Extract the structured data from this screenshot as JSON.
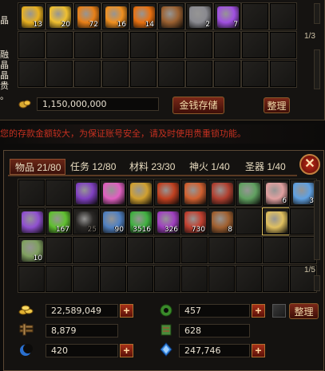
{
  "warehouse": {
    "side_text": [
      "晶",
      "融",
      "晶",
      "晶",
      "贵",
      "。"
    ],
    "page": "1/3",
    "money": "1,150,000,000",
    "store_button": "金钱存储",
    "sort_button": "整理",
    "items": [
      {
        "name": "gold-crystal-icon",
        "qty": "13",
        "color": "#e8b020"
      },
      {
        "name": "gold-shard-icon",
        "qty": "20",
        "color": "#f0c030"
      },
      {
        "name": "fire-orb-icon",
        "qty": "72",
        "color": "#e88018"
      },
      {
        "name": "fire-orb-icon",
        "qty": "16",
        "color": "#f09020"
      },
      {
        "name": "fire-orb-icon",
        "qty": "14",
        "color": "#e87010"
      },
      {
        "name": "armor-icon",
        "qty": "",
        "color": "#9a6030"
      },
      {
        "name": "chest-icon",
        "qty": "2",
        "color": "#8a8a90"
      },
      {
        "name": "purple-gem-icon",
        "qty": "7",
        "color": "#a050e0"
      }
    ]
  },
  "warning": "您的存款金额较大，为保证账号安全，请及时使用贵重锁功能。",
  "bag": {
    "tabs": [
      {
        "label": "物品",
        "count": "21/80"
      },
      {
        "label": "任务",
        "count": "12/80"
      },
      {
        "label": "材料",
        "count": "23/30"
      },
      {
        "label": "神火",
        "count": "1/40"
      },
      {
        "label": "圣器",
        "count": "1/40"
      }
    ],
    "page": "1/5",
    "sort_button": "整理",
    "items_row1": [
      {
        "name": "empty-slot",
        "qty": "",
        "color": ""
      },
      {
        "name": "empty-slot",
        "qty": "",
        "color": ""
      },
      {
        "name": "potion-purple-icon",
        "qty": "",
        "color": "#8040c0"
      },
      {
        "name": "potion-pink-icon",
        "qty": "",
        "color": "#e060c0"
      },
      {
        "name": "golden-key-icon",
        "qty": "",
        "color": "#d0a030"
      },
      {
        "name": "red-rune-icon",
        "qty": "",
        "color": "#c04020"
      },
      {
        "name": "fire-scroll-icon",
        "qty": "",
        "color": "#d06030"
      },
      {
        "name": "red-scroll-icon",
        "qty": "",
        "color": "#b04030"
      },
      {
        "name": "green-scroll-icon",
        "qty": "",
        "color": "#60a060"
      },
      {
        "name": "pink-crystal-icon",
        "qty": "6",
        "color": "#e0a0a0"
      },
      {
        "name": "blue-crystal-icon",
        "qty": "3",
        "color": "#60a0e0"
      }
    ],
    "items_row2": [
      {
        "name": "purple-crystal-icon",
        "qty": "",
        "color": "#9050d0"
      },
      {
        "name": "green-essence-icon",
        "qty": "167",
        "color": "#60c030"
      },
      {
        "name": "faded-item-icon",
        "qty": "25",
        "color": "#2a2826"
      },
      {
        "name": "blue-sword-icon",
        "qty": "90",
        "color": "#5080c0"
      },
      {
        "name": "green-leaf-icon",
        "qty": "3516",
        "color": "#40b040"
      },
      {
        "name": "purple-claw-icon",
        "qty": "326",
        "color": "#a040c0"
      },
      {
        "name": "red-claw-icon",
        "qty": "730",
        "color": "#c04030"
      },
      {
        "name": "bronze-pouch-icon",
        "qty": "8",
        "color": "#a06030"
      },
      {
        "name": "empty-slot",
        "qty": "",
        "color": ""
      },
      {
        "name": "golden-chest-icon",
        "qty": "",
        "color": "#e0c060"
      }
    ],
    "items_row3": [
      {
        "name": "green-tome-icon",
        "qty": "10",
        "color": "#80a060"
      }
    ],
    "resources": {
      "gold": "22,589,049",
      "jade": "457",
      "wood": "8,879",
      "scroll": "628",
      "moon": "420",
      "crystal": "247,746"
    },
    "plus": "+"
  },
  "colors": {
    "accent": "#7a2818",
    "border": "#5a4a34",
    "warning": "#c03020"
  }
}
